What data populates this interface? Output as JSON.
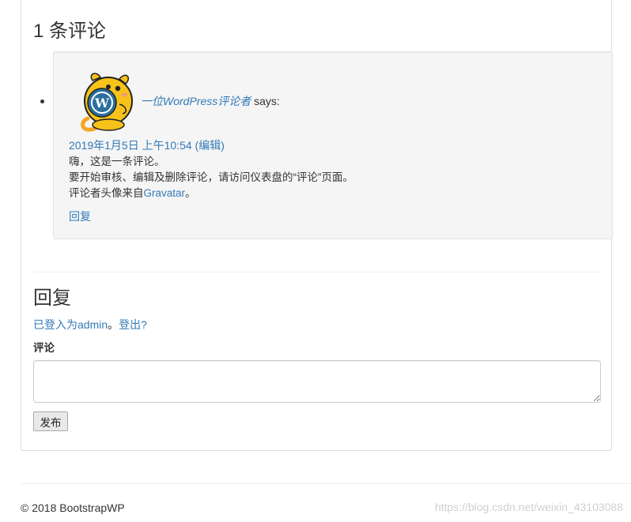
{
  "comments": {
    "title": "1 条评论",
    "items": [
      {
        "author": "一位WordPress评论者",
        "says": "says:",
        "date": "2019年1月5日 上午10:54",
        "edit": "(编辑)",
        "lines": [
          "嗨，这是一条评论。",
          "要开始审核、编辑及删除评论，请访问仪表盘的“评论”页面。"
        ],
        "line3_prefix": "评论者头像来自",
        "line3_link": "Gravatar",
        "line3_suffix": "。",
        "reply": "回复",
        "avatar_icon": "wapuu-avatar"
      }
    ]
  },
  "respond": {
    "title": "回复",
    "logged_in_prefix": "已登入为",
    "user": "admin",
    "separator": "。",
    "logout": "登出?",
    "label": "评论",
    "textarea_value": "",
    "submit": "发布"
  },
  "footer": {
    "text": "© 2018 BootstrapWP",
    "watermark": "https://blog.csdn.net/weixin_43103088"
  },
  "colors": {
    "link": "#337ab7",
    "comment_bg": "#f5f5f5",
    "text": "#333333"
  }
}
